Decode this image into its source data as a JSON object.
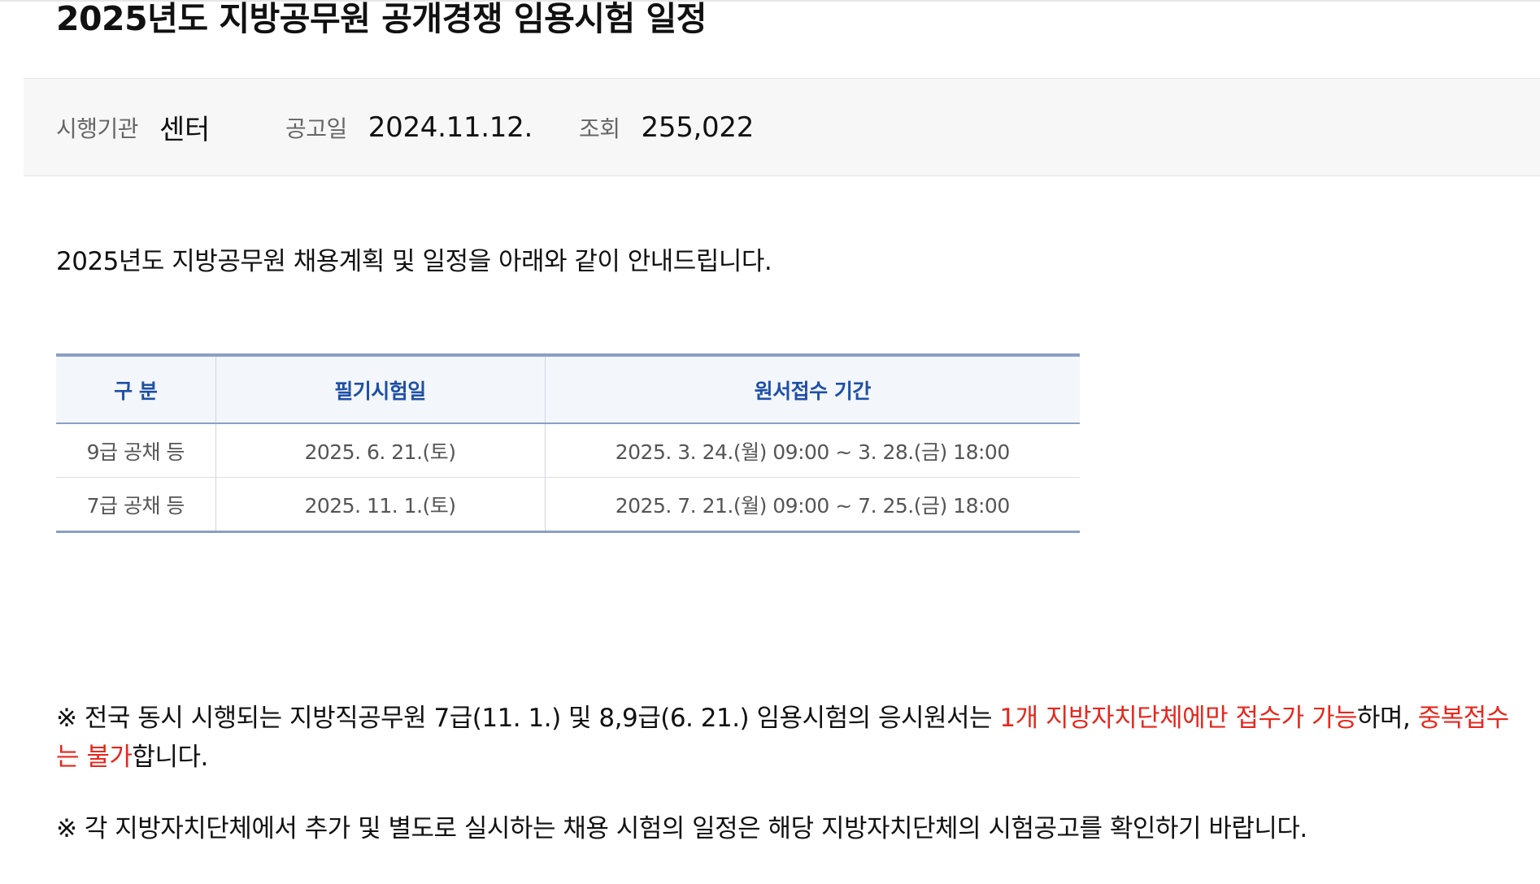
{
  "title": "2025년도 지방공무원 공개경쟁 임용시험 일정",
  "meta": {
    "agency_label": "시행기관",
    "agency_value": "센터",
    "date_label": "공고일",
    "date_value": "2024.11.12.",
    "views_label": "조회",
    "views_value": "255,022"
  },
  "intro": "2025년도 지방공무원 채용계획 및 일정을 아래와 같이 안내드립니다.",
  "table": {
    "headers": [
      "구 분",
      "필기시험일",
      "원서접수 기간"
    ],
    "rows": [
      [
        "9급 공채 등",
        "2025. 6. 21.(토)",
        "2025. 3. 24.(월) 09:00 ~ 3. 28.(금) 18:00"
      ],
      [
        "7급 공채 등",
        "2025. 11. 1.(토)",
        "2025. 7. 21.(월) 09:00 ~ 7. 25.(금) 18:00"
      ]
    ]
  },
  "notes": {
    "note1": {
      "part1": "※ 전국 동시 시행되는 지방직공무원 7급(11. 1.) 및 8,9급(6. 21.) 임용시험의 응시원서는 ",
      "highlight1": "1개 지방자치단체에만 접수가 가능",
      "part2": "하며, ",
      "highlight2": "중복접수는 불가",
      "part3": "합니다."
    },
    "note2": "※ 각 지방자치단체에서 추가 및 별도로 실시하는 채용 시험의 일정은 해당 지방자치단체의 시험공고를 확인하기 바랍니다."
  },
  "colors": {
    "highlight": "#e5281e",
    "table_header_text": "#1e4fa7",
    "table_border": "#8a9fc4"
  }
}
